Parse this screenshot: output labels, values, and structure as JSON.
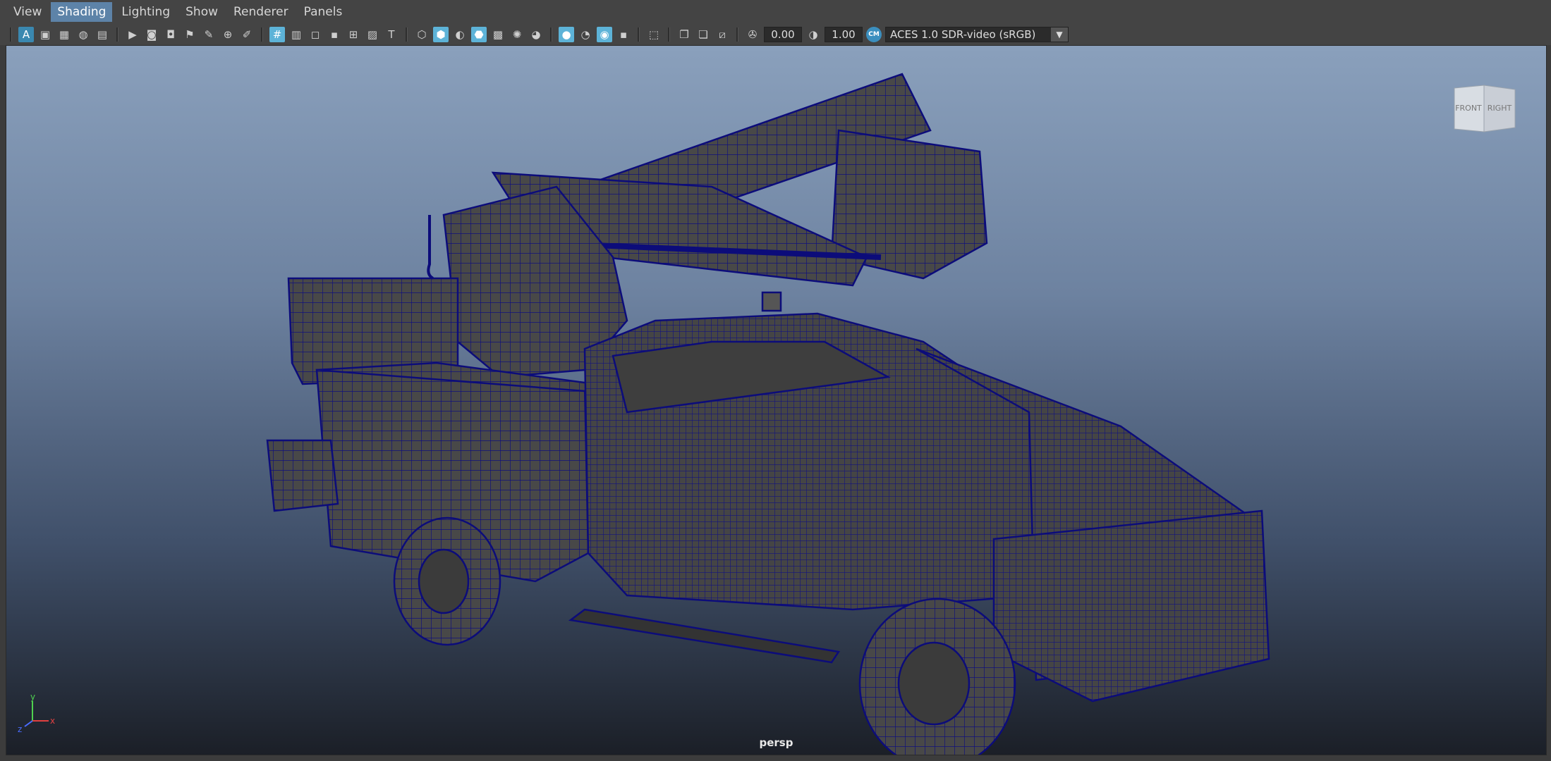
{
  "menu": {
    "items": [
      {
        "id": "view",
        "label": "View"
      },
      {
        "id": "shading",
        "label": "Shading",
        "active": true
      },
      {
        "id": "lighting",
        "label": "Lighting"
      },
      {
        "id": "show",
        "label": "Show"
      },
      {
        "id": "renderer",
        "label": "Renderer"
      },
      {
        "id": "panels",
        "label": "Panels"
      }
    ]
  },
  "toolbar": {
    "exposure_value": "0.00",
    "gamma_value": "1.00",
    "color_space": "ACES 1.0 SDR-video (sRGB)"
  },
  "viewcube": {
    "front_label": "FRONT",
    "right_label": "RIGHT"
  },
  "viewport": {
    "camera_label": "persp"
  },
  "axis": {
    "x_label": "x",
    "y_label": "y",
    "z_label": "z"
  },
  "colors": {
    "wire": "#0c0c7a",
    "body": "#454545",
    "accent": "#5d83a8"
  }
}
